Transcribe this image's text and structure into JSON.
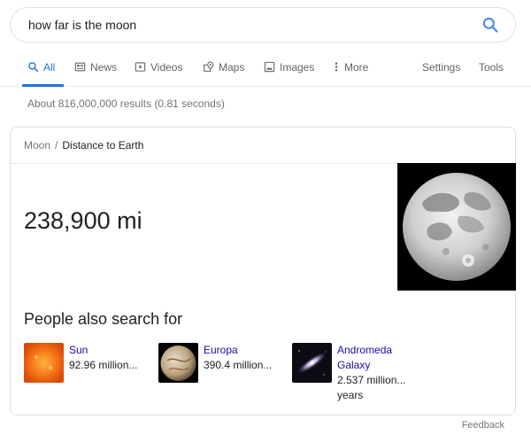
{
  "search": {
    "query": "how far is the moon"
  },
  "tabs": [
    {
      "label": "All",
      "icon": "search-icon",
      "active": true
    },
    {
      "label": "News",
      "icon": "news-icon"
    },
    {
      "label": "Videos",
      "icon": "video-icon"
    },
    {
      "label": "Maps",
      "icon": "map-icon"
    },
    {
      "label": "Images",
      "icon": "image-icon"
    },
    {
      "label": "More",
      "icon": "more-vert-icon"
    }
  ],
  "tools": {
    "settings": "Settings",
    "tools": "Tools"
  },
  "results_count": "About 816,000,000 results (0.81 seconds)",
  "card": {
    "breadcrumb_parent": "Moon",
    "breadcrumb_separator": "/",
    "breadcrumb_current": "Distance to Earth",
    "answer": "238,900 mi",
    "image": "moon-photo",
    "pasf_title": "People also search for",
    "pasf_items": [
      {
        "name": "Sun",
        "detail": "92.96 million...",
        "image": "sun-photo"
      },
      {
        "name": "Europa",
        "detail": "390.4 million...",
        "image": "europa-photo"
      },
      {
        "name": "Andromeda Galaxy",
        "detail": "2.537 million... years",
        "image": "andromeda-photo"
      }
    ]
  },
  "feedback": "Feedback",
  "colors": {
    "accent": "#1a73e8",
    "link": "#1a0dab",
    "muted": "#70757a"
  }
}
